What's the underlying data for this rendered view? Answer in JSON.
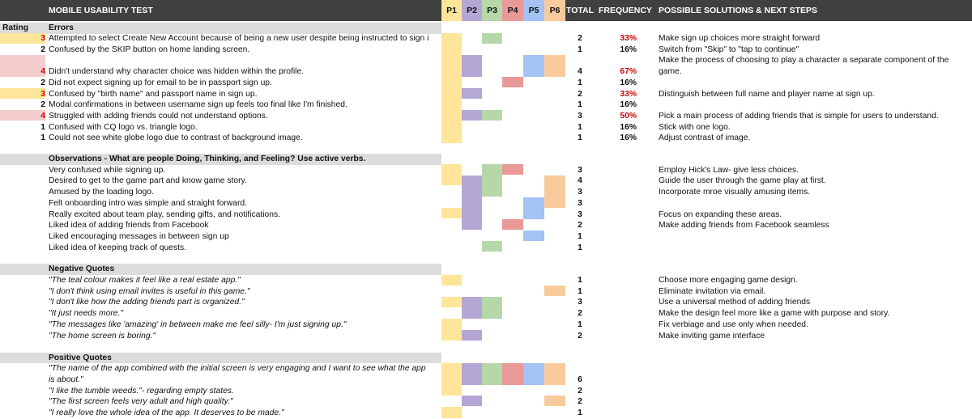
{
  "header": {
    "title": "MOBILE USABILITY TEST",
    "p_cols": [
      "P1",
      "P2",
      "P3",
      "P4",
      "P5",
      "P6"
    ],
    "total": "TOTAL",
    "frequency": "FREQUENCY",
    "solutions": "POSSIBLE SOLUTIONS & NEXT STEPS"
  },
  "colors": {
    "P1": "#ffe599",
    "P2": "#b4a7d6",
    "P3": "#b6d7a8",
    "P4": "#ea9999",
    "P5": "#a4c2f4",
    "P6": "#f9cb9c",
    "rating_3": "#ffe599",
    "rating_4": "#f4cccc"
  },
  "rating_header": "Rating",
  "sections": {
    "errors": "Errors",
    "observations": "Observations - What are people Doing, Thinking, and Feeling? Use active verbs.",
    "negative": "Negative Quotes",
    "positive": "Positive Quotes"
  },
  "errors": [
    {
      "rating": "3",
      "desc": "Attempted to select Create New Account because of being a new user despite being instructed to sign i",
      "total": "2",
      "freq": "33%",
      "solution": "Make sign up choices more straight forward"
    },
    {
      "rating": "2",
      "desc": "Confused by the SKIP button on home landing screen.",
      "total": "1",
      "freq": "16%",
      "solution": "Switch from \"Skip\" to \"tap to continue\""
    },
    {
      "rating": "",
      "desc": "",
      "total": "",
      "freq": "",
      "solution": "Make the process of choosing to play a character a separate component of the"
    },
    {
      "rating": "4",
      "desc": "Didn't understand why character choice was hidden within the profile.",
      "total": "4",
      "freq": "67%",
      "solution": "game."
    },
    {
      "rating": "2",
      "desc": "Did not expect signing up for email to be in passport sign up.",
      "total": "1",
      "freq": "16%",
      "solution": ""
    },
    {
      "rating": "3",
      "desc": "Confused by \"birth name\" and passport name in sign up.",
      "total": "2",
      "freq": "33%",
      "solution": "Distinguish between full name and player name at sign up."
    },
    {
      "rating": "2",
      "desc": "Modal confirmations in between username sign up feels too final like I'm finished.",
      "total": "1",
      "freq": "16%",
      "solution": ""
    },
    {
      "rating": "4",
      "desc": "Struggled with adding friends could not understand options.",
      "total": "3",
      "freq": "50%",
      "solution": "Pick a main process of adding friends that is simple for users to understand."
    },
    {
      "rating": "1",
      "desc": "Confused with CQ logo vs. triangle logo.",
      "total": "1",
      "freq": "16%",
      "solution": "Stick with one logo."
    },
    {
      "rating": "1",
      "desc": "Could not see white globe logo due to contrast of background image.",
      "total": "1",
      "freq": "16%",
      "solution": "Adjust contrast of image."
    }
  ],
  "observations": [
    {
      "desc": "Very confused while signing up.",
      "total": "3",
      "solution": "Employ Hick's Law- give less choices."
    },
    {
      "desc": "Desired to get to the game part and know game story.",
      "total": "4",
      "solution": "Guide the user through the game play at first."
    },
    {
      "desc": "Amused by the loading logo.",
      "total": "3",
      "solution": "Incorporate mroe visually amusing items."
    },
    {
      "desc": "Felt onboarding intro was simple and straight forward.",
      "total": "3",
      "solution": ""
    },
    {
      "desc": "Really excited about team play, sending gifts, and notifications.",
      "total": "3",
      "solution": "Focus on expanding these areas."
    },
    {
      "desc": "Liked idea of adding friends from Facebook",
      "total": "2",
      "solution": "Make adding friends from Facebook seamless"
    },
    {
      "desc": "Liked encouraging messages in between sign up",
      "total": "1",
      "solution": ""
    },
    {
      "desc": "Liked idea of keeping track of quests.",
      "total": "1",
      "solution": ""
    }
  ],
  "negative": [
    {
      "desc": "\"The teal colour makes it feel like a real estate app.\"",
      "total": "1",
      "solution": "Choose more engaging game design."
    },
    {
      "desc": "\"I don't think using email invites is useful in this game.\"",
      "total": "1",
      "solution": "Eliminate invitation via email."
    },
    {
      "desc": "\"I don't like how the adding friends part is organized.\"",
      "total": "3",
      "solution": "Use a universal method of adding friends"
    },
    {
      "desc": "\"It just needs more.\"",
      "total": "2",
      "solution": "Make the design feel more like a game with purpose and story."
    },
    {
      "desc": "\"The messages like 'amazing' in between make me feel silly- I'm just signing up.\"",
      "total": "1",
      "solution": "Fix verbiage and use only when needed."
    },
    {
      "desc": "\"The home screen is boring.\"",
      "total": "2",
      "solution": "Make inviting game interface"
    }
  ],
  "positive": [
    {
      "desc": "\"The name of the app combined with the initial screen is very engaging and I want to see what the app",
      "total": ""
    },
    {
      "desc": "is about.\"",
      "total": "6"
    },
    {
      "desc": "\"I like the tumble weeds.\"- regarding empty states.",
      "total": "2"
    },
    {
      "desc": "\"The first screen feels very adult and high quality.\"",
      "total": "2"
    },
    {
      "desc": "\"I really love the whole idea of the app.  It deserves to be made.\"",
      "total": "1"
    }
  ]
}
